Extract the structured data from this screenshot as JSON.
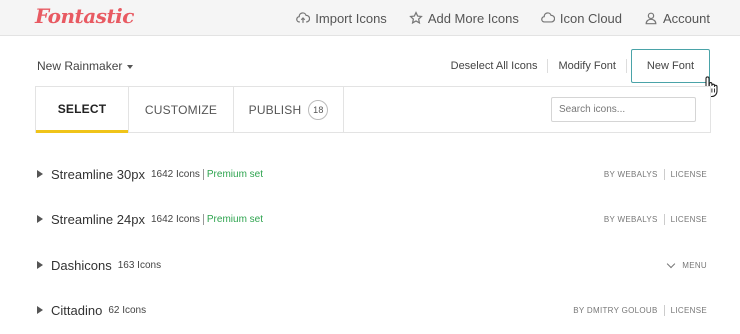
{
  "brand": {
    "logo_text": "Fontastic",
    "logo_color": "#e85a62"
  },
  "nav": {
    "items": [
      {
        "label": "Import Icons",
        "icon": "cloud-upload-icon"
      },
      {
        "label": "Add More Icons",
        "icon": "star-icon"
      },
      {
        "label": "Icon Cloud",
        "icon": "cloud-icon"
      },
      {
        "label": "Account",
        "icon": "user-icon"
      }
    ]
  },
  "font_selector": {
    "label": "New Rainmaker"
  },
  "actions": {
    "deselect": "Deselect All Icons",
    "modify": "Modify Font",
    "new_font": "New Font"
  },
  "tabs": {
    "select": "SELECT",
    "customize": "CUSTOMIZE",
    "publish": "PUBLISH",
    "publish_count": "18"
  },
  "search": {
    "placeholder": "Search icons...",
    "value": ""
  },
  "icon_sets": [
    {
      "name": "Streamline 30px",
      "count": "1642 Icons",
      "premium": "Premium set",
      "author": "BY WEBALYS",
      "license": "LICENSE"
    },
    {
      "name": "Streamline 24px",
      "count": "1642 Icons",
      "premium": "Premium set",
      "author": "BY WEBALYS",
      "license": "LICENSE"
    },
    {
      "name": "Dashicons",
      "count": "163 Icons",
      "menu": "MENU"
    },
    {
      "name": "Cittadino",
      "count": "62 Icons",
      "author": "BY DMITRY GOLOUB",
      "license": "LICENSE"
    }
  ],
  "colors": {
    "accent_tab": "#f0c419",
    "primary_border": "#4aa3a8",
    "premium_green": "#2ea44f"
  }
}
